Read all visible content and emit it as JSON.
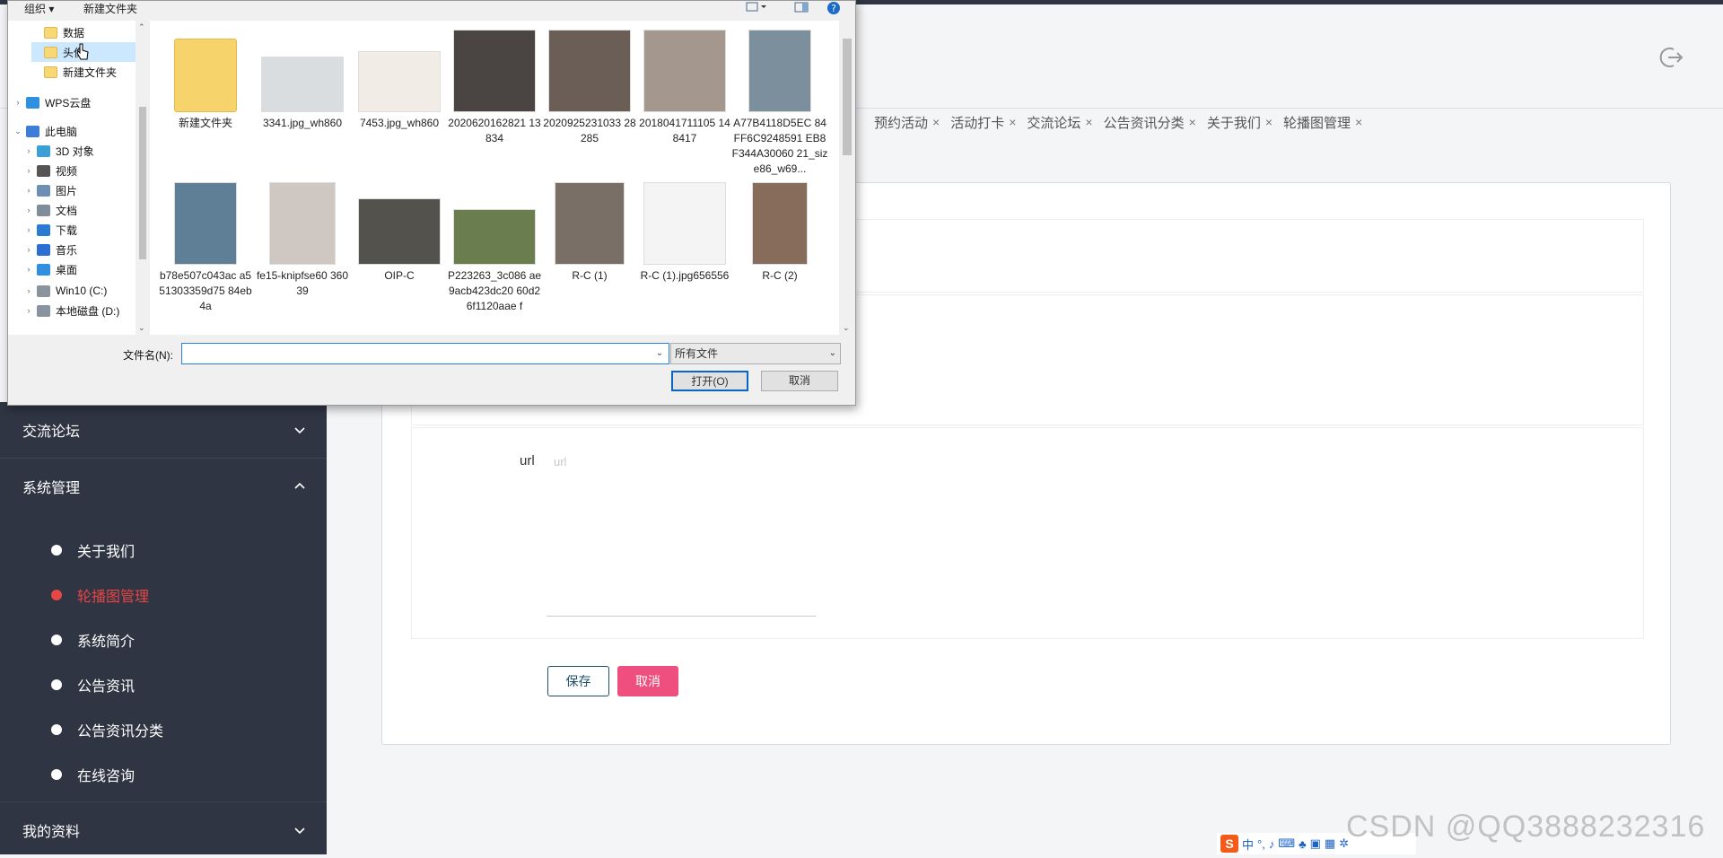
{
  "dialog": {
    "toolbar": {
      "organize": "组织 ▾",
      "new_folder": "新建文件夹"
    },
    "tree": [
      {
        "label": "数据",
        "icon": "folder-icon",
        "arrow": ""
      },
      {
        "label": "头像",
        "icon": "folder-icon",
        "arrow": "",
        "selected": true
      },
      {
        "label": "新建文件夹",
        "icon": "folder-icon",
        "arrow": ""
      },
      {
        "label": "WPS云盘",
        "icon": "cloud-icon",
        "arrow": "›"
      },
      {
        "label": "此电脑",
        "icon": "computer-icon",
        "arrow": "⌄"
      },
      {
        "label": "3D 对象",
        "icon": "cube-icon",
        "arrow": "›"
      },
      {
        "label": "视频",
        "icon": "video-icon",
        "arrow": "›"
      },
      {
        "label": "图片",
        "icon": "picture-icon",
        "arrow": "›"
      },
      {
        "label": "文档",
        "icon": "document-icon",
        "arrow": "›"
      },
      {
        "label": "下载",
        "icon": "download-icon",
        "arrow": "›"
      },
      {
        "label": "音乐",
        "icon": "music-icon",
        "arrow": "›"
      },
      {
        "label": "桌面",
        "icon": "desktop-icon",
        "arrow": "›"
      },
      {
        "label": "Win10 (C:)",
        "icon": "drive-icon",
        "arrow": "›"
      },
      {
        "label": "本地磁盘 (D:)",
        "icon": "drive-icon",
        "arrow": "›"
      }
    ],
    "files": [
      {
        "name": "新建文件夹",
        "kind": "folder"
      },
      {
        "name": "3341.jpg_wh860",
        "kind": "image",
        "color": "#d9dde0"
      },
      {
        "name": "7453.jpg_wh860",
        "kind": "image",
        "color": "#f1ece6"
      },
      {
        "name": "2020620162821 13834",
        "kind": "image",
        "color": "#4a4442"
      },
      {
        "name": "2020925231033 28285",
        "kind": "image",
        "color": "#6b5e56"
      },
      {
        "name": "2018041711105 148417",
        "kind": "image",
        "color": "#a3978e"
      },
      {
        "name": "A77B4118D5EC 84FF6C9248591 EB8F344A30060 21_size86_w69...",
        "kind": "image",
        "color": "#7c8f9c"
      },
      {
        "name": "b78e507c043ac a551303359d75 84eb4a",
        "kind": "image",
        "color": "#5f7f97"
      },
      {
        "name": "fe15-knipfse60 36039",
        "kind": "image",
        "color": "#cfc7c2"
      },
      {
        "name": "OIP-C",
        "kind": "image",
        "color": "#54524d"
      },
      {
        "name": "P223263_3c086 ae9acb423dc20 60d26f1120aae f",
        "kind": "image",
        "color": "#6a7d4f"
      },
      {
        "name": "R-C (1)",
        "kind": "image",
        "color": "#7a6f66"
      },
      {
        "name": "R-C (1).jpg656556",
        "kind": "image",
        "color": "#f4f4f4"
      },
      {
        "name": "R-C (2)",
        "kind": "image",
        "color": "#876b5b"
      }
    ],
    "filename_label": "文件名(N):",
    "filename_value": "",
    "filter": "所有文件",
    "open_button": "打开(O)",
    "cancel_button": "取消"
  },
  "tabs": [
    {
      "label": "预约活动"
    },
    {
      "label": "活动打卡"
    },
    {
      "label": "交流论坛"
    },
    {
      "label": "公告资讯分类"
    },
    {
      "label": "关于我们"
    },
    {
      "label": "轮播图管理"
    }
  ],
  "tab_close": "×",
  "sidebar": {
    "forum": "交流论坛",
    "system": "系统管理",
    "sub_items": [
      {
        "label": "关于我们",
        "active": false
      },
      {
        "label": "轮播图管理",
        "active": true
      },
      {
        "label": "系统简介",
        "active": false
      },
      {
        "label": "公告资讯",
        "active": false
      },
      {
        "label": "公告资讯分类",
        "active": false
      },
      {
        "label": "在线咨询",
        "active": false
      }
    ],
    "profile": "我的资料"
  },
  "form": {
    "url_label": "url",
    "url_placeholder": "url",
    "save_button": "保存",
    "cancel_button": "取消"
  },
  "ime": {
    "logo": "S",
    "mode": "中"
  },
  "watermark": "CSDN @QQ3888232316",
  "colors": {
    "sidebar_bg": "#2f3542",
    "active_red": "#e84545",
    "cancel_pink": "#ef4f7f",
    "save_border": "#1e4f6a"
  }
}
